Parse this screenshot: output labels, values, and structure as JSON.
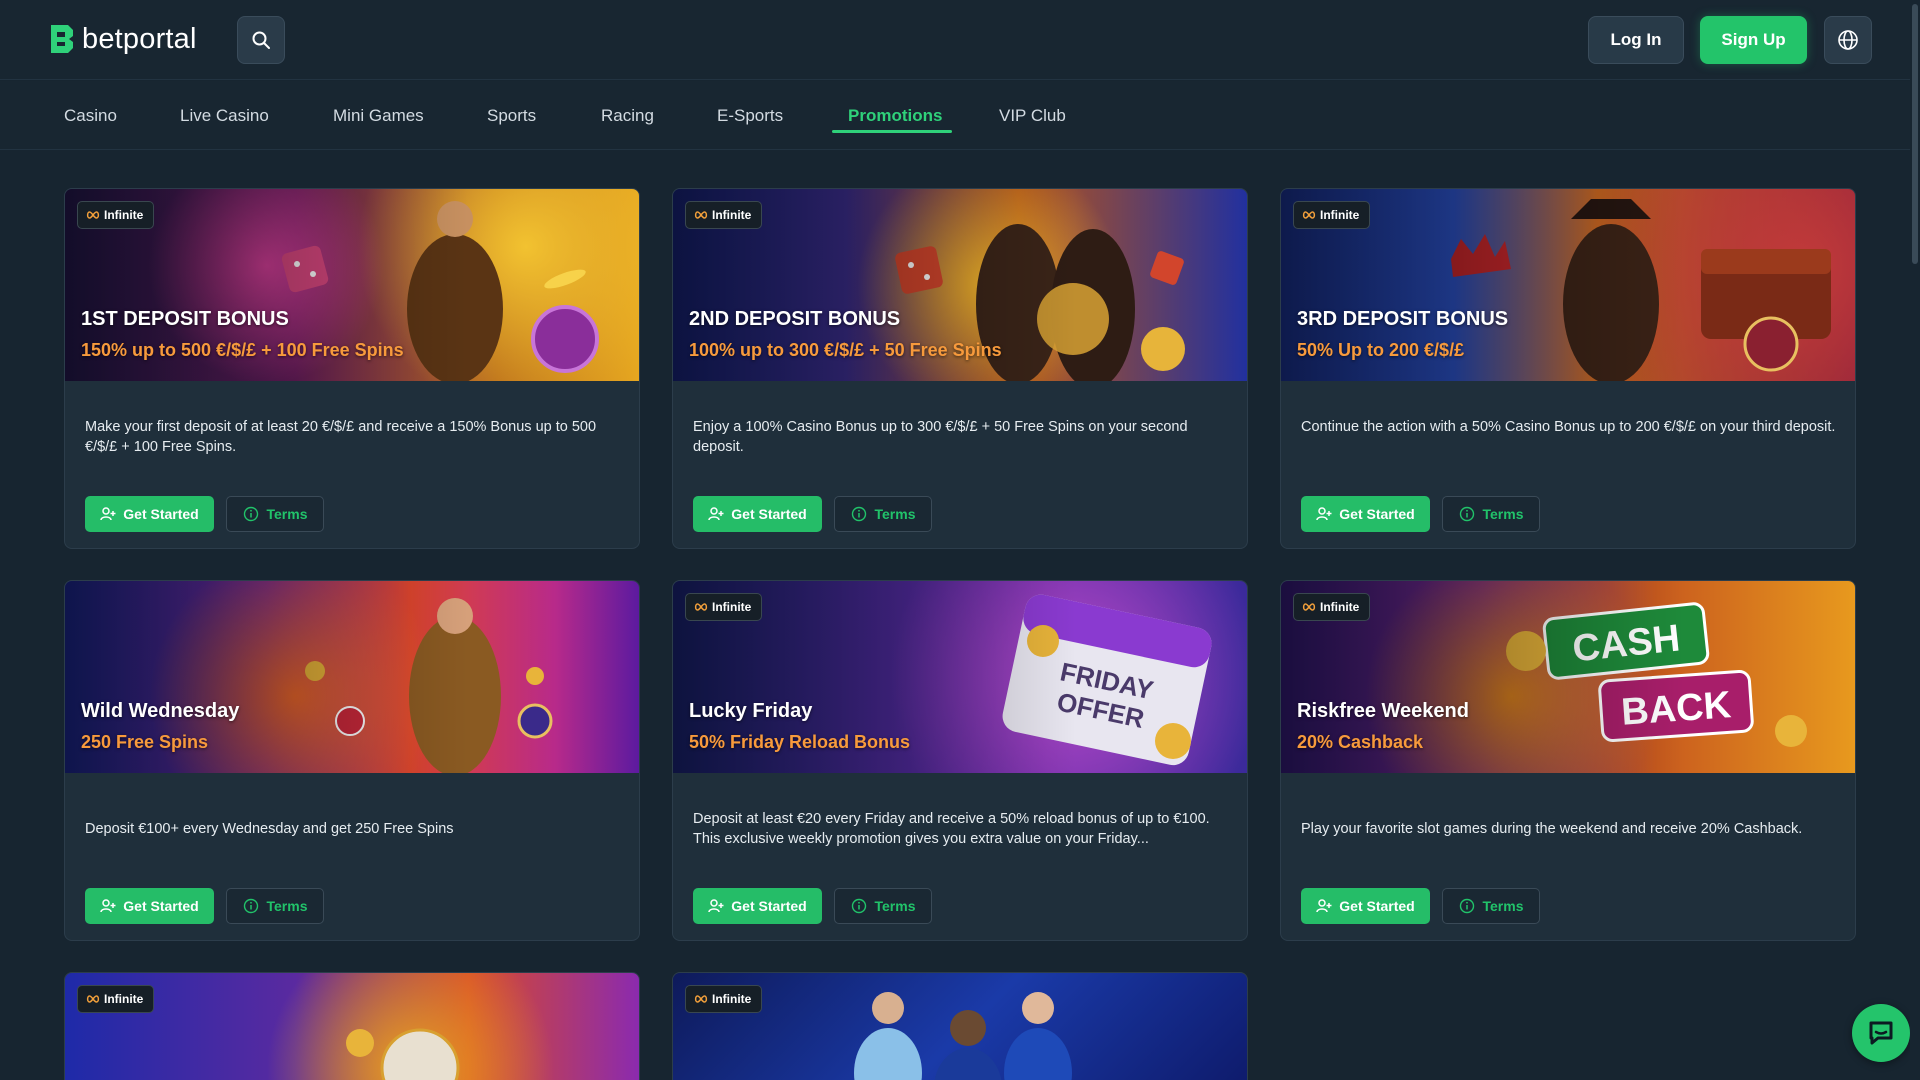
{
  "header": {
    "logo_text": "betportal",
    "login_label": "Log In",
    "signup_label": "Sign Up",
    "icons": [
      "search-icon",
      "globe-icon"
    ]
  },
  "nav": {
    "items": [
      "Casino",
      "Live Casino",
      "Mini Games",
      "Sports",
      "Racing",
      "E-Sports",
      "Promotions",
      "VIP Club"
    ],
    "active": "Promotions"
  },
  "promotions": [
    {
      "badge": "Infinite",
      "title": "1ST DEPOSIT BONUS",
      "subtitle": "150% up to 500 €/$/£ + 100 Free Spins",
      "description": "Make your first deposit of at least 20 €/$/£ and receive a 150% Bonus up to 500 €/$/£ + 100 Free Spins.",
      "cta": "Get Started",
      "terms": "Terms"
    },
    {
      "badge": "Infinite",
      "title": "2ND DEPOSIT BONUS",
      "subtitle": "100% up to 300 €/$/£ + 50 Free Spins",
      "description": "Enjoy a 100% Casino Bonus up to 300 €/$/£ + 50 Free Spins on your second deposit.",
      "cta": "Get Started",
      "terms": "Terms"
    },
    {
      "badge": "Infinite",
      "title": "3RD DEPOSIT BONUS",
      "subtitle": "50% Up to 200 €/$/£",
      "description": "Continue the action with a 50% Casino Bonus up to 200 €/$/£ on your third deposit.",
      "cta": "Get Started",
      "terms": "Terms"
    },
    {
      "badge": "",
      "title": "Wild Wednesday",
      "subtitle": "250 Free Spins",
      "description": "Deposit €100+ every Wednesday and get 250 Free Spins",
      "cta": "Get Started",
      "terms": "Terms"
    },
    {
      "badge": "Infinite",
      "title": "Lucky Friday",
      "subtitle": "50% Friday Reload Bonus",
      "description": "Deposit at least €20 every Friday and receive a 50% reload bonus of up to €100. This exclusive weekly promotion gives you extra value on your Friday...",
      "banner_art_text": "FRIDAY OFFER",
      "cta": "Get Started",
      "terms": "Terms"
    },
    {
      "badge": "Infinite",
      "title": "Riskfree Weekend",
      "subtitle": "20% Cashback",
      "description": "Play your favorite slot games during the weekend and receive 20% Cashback.",
      "banner_art_text": "CASH BACK",
      "cta": "Get Started",
      "terms": "Terms"
    },
    {
      "badge": "Infinite"
    },
    {
      "badge": "Infinite"
    }
  ],
  "colors": {
    "background": "#172530",
    "card": "#1f2f3b",
    "accent_green": "#23c46a",
    "subtitle_orange": "#f79a3c"
  }
}
